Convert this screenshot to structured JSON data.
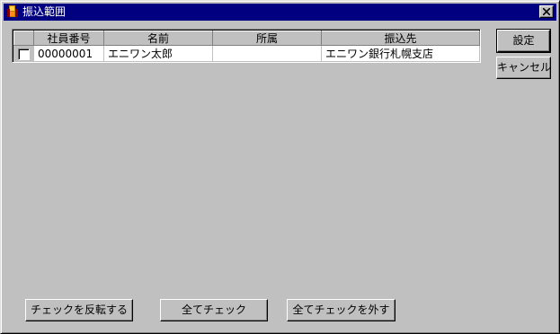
{
  "window": {
    "title": "振込範囲",
    "icon": "app-icon",
    "close_icon": "close-icon"
  },
  "table": {
    "columns": [
      "",
      "社員番号",
      "名前",
      "所属",
      "振込先"
    ],
    "rows": [
      {
        "checked": false,
        "employee_id": "00000001",
        "name": "エニワン太郎",
        "department": "",
        "bank": "エニワン銀行札幌支店"
      }
    ]
  },
  "side_buttons": {
    "ok": "設定",
    "cancel": "キャンセル"
  },
  "bottom_buttons": {
    "invert": "チェックを反転する",
    "check_all": "全てチェック",
    "uncheck_all": "全てチェックを外す"
  },
  "colors": {
    "titlebar": "#000080",
    "face": "#c0c0c0"
  }
}
